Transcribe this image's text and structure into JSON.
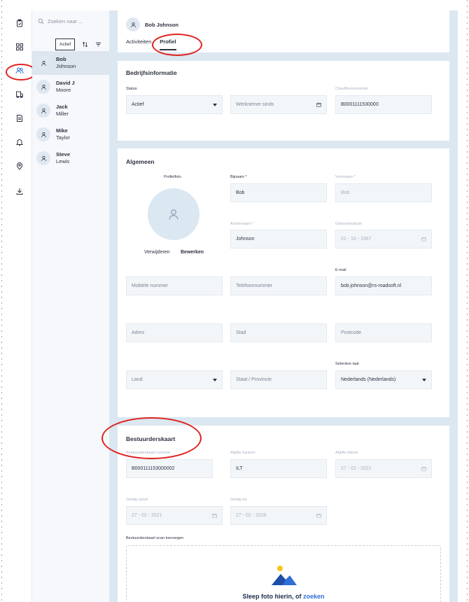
{
  "search": {
    "placeholder": "Zoeken naar ..."
  },
  "filter": {
    "chip": "Actief"
  },
  "people": [
    {
      "first": "Bob",
      "last": "Johnson"
    },
    {
      "first": "David J",
      "last": "Moore"
    },
    {
      "first": "Jack",
      "last": "Miller"
    },
    {
      "first": "Mike",
      "last": "Taylor"
    },
    {
      "first": "Steve",
      "last": "Lewis"
    }
  ],
  "header": {
    "name": "Bob Johnson",
    "tabs": [
      "Activiteiten",
      "Profiel"
    ]
  },
  "company": {
    "title": "Bedrijfsinformatie",
    "status_label": "Status",
    "status_value": "Actief",
    "employee_since": "Werknemer sinds",
    "driver_no_label": "Chauffeursnummer",
    "driver_no": "B0001111530000"
  },
  "general": {
    "title": "Algemeen",
    "photo_label": "Profielfoto",
    "remove": "Verwijderen",
    "edit": "Bewerken",
    "nickname_label": "Bijnaam *",
    "nickname": "Bob",
    "firstname_label": "Voornaam *",
    "firstname": "Bob",
    "lastname_label": "Achternaam *",
    "lastname": "Johnson",
    "birthdate_label": "Geboortedatum",
    "birthdate": "01 - 10 - 1987",
    "mobile": "Mobiele nummer",
    "phone": "Telefoonnummer",
    "email_label": "E-mail",
    "email": "bob.johnson@rs-roadsoft.nl",
    "address": "Adres",
    "city": "Stad",
    "postcode": "Postcode",
    "country": "Land",
    "state": "Staat / Provincie",
    "language_label": "Selecteer taal",
    "language": "Nederlands (Nederlands)"
  },
  "card": {
    "title": "Bestuurderskaart",
    "number_label": "Bestuurderskaart nummer",
    "number": "B000111153000002",
    "office_label": "Afgifte kantoor",
    "office": "ILT",
    "issue_label": "Afgifte datum",
    "issue": "27 - 02 - 2021",
    "valid_from_label": "Geldig vanaf",
    "valid_from": "27 - 02 - 2021",
    "valid_to_label": "Geldig tot",
    "valid_to": "27 - 02 - 2026",
    "scan_label": "Bestuurderskaart scan toevoegen",
    "drop_text": "Sleep foto hierin, of",
    "drop_link": "zoeken"
  },
  "colors": {
    "accent": "#2f6fd6",
    "highlight": "#e0211d",
    "panel": "#dbe7f1"
  },
  "icons": [
    "clipboard-icon",
    "grid-icon",
    "users-icon",
    "truck-doc-icon",
    "document-icon",
    "bell-icon",
    "map-pin-icon",
    "download-icon"
  ]
}
